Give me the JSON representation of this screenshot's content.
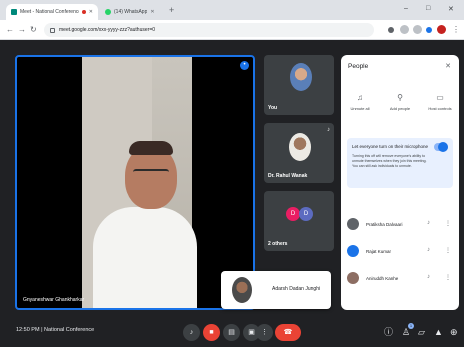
{
  "browser": {
    "tabs": [
      {
        "title": "Meet - National Conference",
        "favicon_color": "#00897b"
      },
      {
        "title": "(14) WhatsApp",
        "favicon_color": "#25d366"
      }
    ],
    "url": "meet.google.com/xxx-yyyy-zzz?authuser=0",
    "controls": {
      "minimize": "–",
      "maximize": "□",
      "close": "✕",
      "new_tab": "+"
    }
  },
  "meeting": {
    "main_speaker": "Gnyaneshwar Ghankharkar",
    "tiles": [
      {
        "name": "You",
        "kind": "photo"
      },
      {
        "name": "Dr. Rahul Wanak",
        "kind": "photo"
      },
      {
        "name": "2 others",
        "kind": "avatars",
        "avatars": [
          "D",
          "D"
        ]
      }
    ],
    "floating_participant": "Adarsh Dadan Junghi",
    "time": "12:50 PM",
    "separator": "|",
    "meeting_name": "National Conference",
    "details_badge": "1"
  },
  "people_panel": {
    "title": "People",
    "actions": [
      {
        "label": "Unmute all",
        "icon": "mic-icon"
      },
      {
        "label": "Add people",
        "icon": "add-person-icon"
      },
      {
        "label": "Host controls",
        "icon": "shield-icon"
      }
    ],
    "lock": {
      "title": "Let everyone turn on their microphone",
      "description": "Turning this off will remove everyone's ability to unmute themselves when they join this meeting. You can still ask individuals to unmute."
    },
    "participants": [
      {
        "name": "Pratiksha Dalvaari",
        "avatar_color": "#5f6368"
      },
      {
        "name": "Rajat Kumar",
        "avatar_color": "#1a73e8"
      },
      {
        "name": "Aniruddh Kanhe",
        "avatar_color": "#8d6e63"
      }
    ]
  },
  "colors": {
    "accent": "#1a73e8",
    "danger": "#ea4335",
    "stage": "#202124",
    "tile": "#3c4043"
  }
}
